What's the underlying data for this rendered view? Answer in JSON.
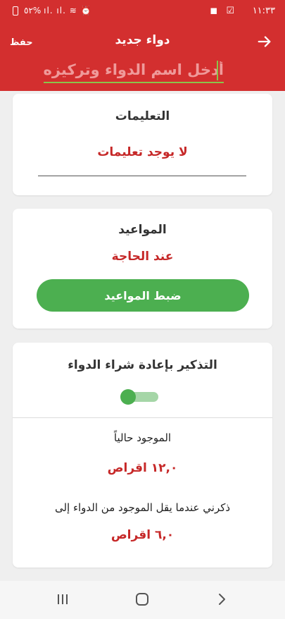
{
  "status_bar": {
    "time": "١١:٣٣",
    "battery": "٥٢%",
    "left_icons": "ıl. ıl. ≋ ⏰",
    "right_icons": "◼ ☑"
  },
  "app_bar": {
    "title": "دواء جديد",
    "save_label": "حفظ",
    "back_icon": "arrow-right-icon",
    "name_placeholder": "أدخل اسم الدواء وتركيزه"
  },
  "instructions": {
    "title": "التعليمات",
    "value": "لا يوجد تعليمات"
  },
  "schedule": {
    "title": "المواعيد",
    "value": "عند الحاجة",
    "button_label": "ضبط المواعيد"
  },
  "refill": {
    "title": "التذكير بإعادة شراء الدواء",
    "toggle_on": true,
    "current_label": "الموجود حالياً",
    "current_value": "١٢,٠ اقراص",
    "remind_label": "ذكرني عندما يقل الموجود من الدواء إلى",
    "remind_value": "٦,٠ اقراص"
  },
  "nav_bar": {
    "recents_icon": "recents-icon",
    "home_icon": "home-icon",
    "back_icon": "back-icon"
  },
  "colors": {
    "primary": "#d32f2f",
    "accent_green": "#4caf50",
    "value_red": "#c62828"
  }
}
